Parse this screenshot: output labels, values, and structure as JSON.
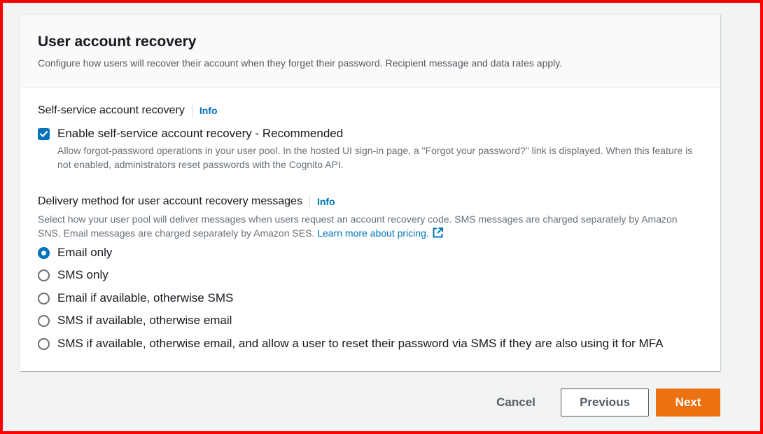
{
  "card": {
    "title": "User account recovery",
    "description": "Configure how users will recover their account when they forget their password. Recipient message and data rates apply."
  },
  "self_service": {
    "label": "Self-service account recovery",
    "info": "Info",
    "checkbox_label": "Enable self-service account recovery - Recommended",
    "checkbox_checked": true,
    "checkbox_description": "Allow forgot-password operations in your user pool. In the hosted UI sign-in page, a \"Forgot your password?\" link is displayed. When this feature is not enabled, administrators reset passwords with the Cognito API."
  },
  "delivery": {
    "label": "Delivery method for user account recovery messages",
    "info": "Info",
    "description": "Select how your user pool will deliver messages when users request an account recovery code. SMS messages are charged separately by Amazon SNS. Email messages are charged separately by Amazon SES.",
    "learn_more": "Learn more about pricing.",
    "selected_index": 0,
    "options": [
      {
        "label": "Email only"
      },
      {
        "label": "SMS only"
      },
      {
        "label": "Email if available, otherwise SMS"
      },
      {
        "label": "SMS if available, otherwise email"
      },
      {
        "label": "SMS if available, otherwise email, and allow a user to reset their password via SMS if they are also using it for MFA"
      }
    ]
  },
  "footer": {
    "cancel": "Cancel",
    "previous": "Previous",
    "next": "Next"
  },
  "colors": {
    "accent": "#0073bb",
    "primary_button": "#ec7211",
    "frame": "#ff0000"
  }
}
